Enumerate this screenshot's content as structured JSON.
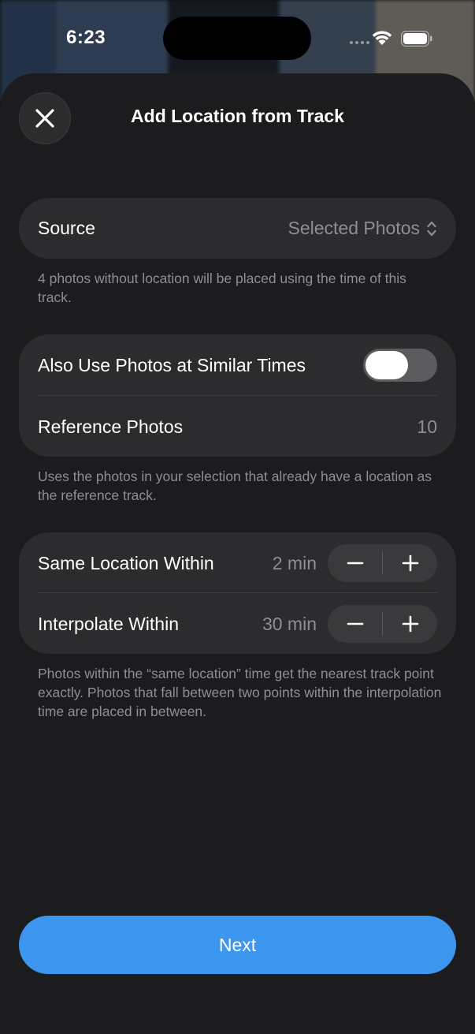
{
  "status_bar": {
    "time": "6:23"
  },
  "header": {
    "title": "Add Location from Track"
  },
  "source_section": {
    "label": "Source",
    "value": "Selected Photos",
    "footnote": "4 photos without location will be placed using the time of this track."
  },
  "reference_section": {
    "similar_label": "Also Use Photos at Similar Times",
    "similar_enabled": true,
    "reference_label": "Reference Photos",
    "reference_count": "10",
    "footnote": "Uses the photos in your selection that already have a location as the reference track."
  },
  "timing_section": {
    "same_location_label": "Same Location Within",
    "same_location_value": "2 min",
    "interpolate_label": "Interpolate Within",
    "interpolate_value": "30 min",
    "footnote": "Photos within the “same location” time get the nearest track point exactly. Photos that fall between two points within the interpolation time are placed in between."
  },
  "footer": {
    "next_label": "Next"
  },
  "colors": {
    "sheet": "#1c1c1e",
    "card": "#2c2c2e",
    "secondary_text": "#8e8e93",
    "accent": "#3d96ee"
  }
}
